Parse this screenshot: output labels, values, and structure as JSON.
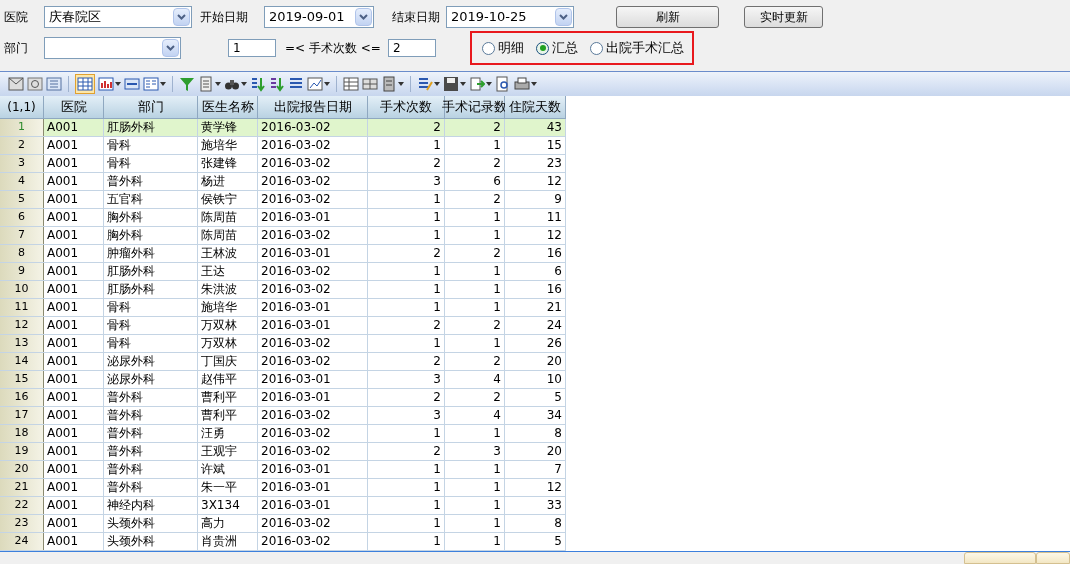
{
  "filters": {
    "hospital_label": "医院",
    "hospital": "庆春院区",
    "start_label": "开始日期",
    "start_date": "2019-09-01",
    "end_label": "结束日期",
    "end_date": "2019-10-25",
    "dept_label": "部门",
    "min_count": "1",
    "range_label": "=< 手术次数 <=",
    "max_count": "2"
  },
  "buttons": [
    "刷新",
    "实时更新"
  ],
  "view_options": [
    {
      "label": "明细",
      "selected": false
    },
    {
      "label": "汇总",
      "selected": true
    },
    {
      "label": "出院手术汇总",
      "selected": false
    }
  ],
  "table": {
    "corner": "(1,1)",
    "columns": [
      "医院",
      "部门",
      "医生名称",
      "出院报告日期",
      "手术次数",
      "手术记录数",
      "住院天数"
    ],
    "rows": [
      {
        "num": "1",
        "selected": true,
        "cells": [
          "A001",
          "肛肠外科",
          "黄学锋",
          "2016-03-02",
          "2",
          "2",
          "43"
        ]
      },
      {
        "num": "2",
        "selected": false,
        "cells": [
          "A001",
          "骨科",
          "施培华",
          "2016-03-02",
          "1",
          "1",
          "15"
        ]
      },
      {
        "num": "3",
        "selected": false,
        "cells": [
          "A001",
          "骨科",
          "张建锋",
          "2016-03-02",
          "2",
          "2",
          "23"
        ]
      },
      {
        "num": "4",
        "selected": false,
        "cells": [
          "A001",
          "普外科",
          "杨进",
          "2016-03-02",
          "3",
          "6",
          "12"
        ]
      },
      {
        "num": "5",
        "selected": false,
        "cells": [
          "A001",
          "五官科",
          "侯铁宁",
          "2016-03-02",
          "1",
          "2",
          "9"
        ]
      },
      {
        "num": "6",
        "selected": false,
        "cells": [
          "A001",
          "胸外科",
          "陈周苗",
          "2016-03-01",
          "1",
          "1",
          "11"
        ]
      },
      {
        "num": "7",
        "selected": false,
        "cells": [
          "A001",
          "胸外科",
          "陈周苗",
          "2016-03-02",
          "1",
          "1",
          "12"
        ]
      },
      {
        "num": "8",
        "selected": false,
        "cells": [
          "A001",
          "肿瘤外科",
          "王林波",
          "2016-03-01",
          "2",
          "2",
          "16"
        ]
      },
      {
        "num": "9",
        "selected": false,
        "cells": [
          "A001",
          "肛肠外科",
          "王达",
          "2016-03-02",
          "1",
          "1",
          "6"
        ]
      },
      {
        "num": "10",
        "selected": false,
        "cells": [
          "A001",
          "肛肠外科",
          "朱洪波",
          "2016-03-02",
          "1",
          "1",
          "16"
        ]
      },
      {
        "num": "11",
        "selected": false,
        "cells": [
          "A001",
          "骨科",
          "施培华",
          "2016-03-01",
          "1",
          "1",
          "21"
        ]
      },
      {
        "num": "12",
        "selected": false,
        "cells": [
          "A001",
          "骨科",
          "万双林",
          "2016-03-01",
          "2",
          "2",
          "24"
        ]
      },
      {
        "num": "13",
        "selected": false,
        "cells": [
          "A001",
          "骨科",
          "万双林",
          "2016-03-02",
          "1",
          "1",
          "26"
        ]
      },
      {
        "num": "14",
        "selected": false,
        "cells": [
          "A001",
          "泌尿外科",
          "丁国庆",
          "2016-03-02",
          "2",
          "2",
          "20"
        ]
      },
      {
        "num": "15",
        "selected": false,
        "cells": [
          "A001",
          "泌尿外科",
          "赵伟平",
          "2016-03-01",
          "3",
          "4",
          "10"
        ]
      },
      {
        "num": "16",
        "selected": false,
        "cells": [
          "A001",
          "普外科",
          "曹利平",
          "2016-03-01",
          "2",
          "2",
          "5"
        ]
      },
      {
        "num": "17",
        "selected": false,
        "cells": [
          "A001",
          "普外科",
          "曹利平",
          "2016-03-02",
          "3",
          "4",
          "34"
        ]
      },
      {
        "num": "18",
        "selected": false,
        "cells": [
          "A001",
          "普外科",
          "汪勇",
          "2016-03-02",
          "1",
          "1",
          "8"
        ]
      },
      {
        "num": "19",
        "selected": false,
        "cells": [
          "A001",
          "普外科",
          "王观宇",
          "2016-03-02",
          "2",
          "3",
          "20"
        ]
      },
      {
        "num": "20",
        "selected": false,
        "cells": [
          "A001",
          "普外科",
          "许斌",
          "2016-03-01",
          "1",
          "1",
          "7"
        ]
      },
      {
        "num": "21",
        "selected": false,
        "cells": [
          "A001",
          "普外科",
          "朱一平",
          "2016-03-01",
          "1",
          "1",
          "12"
        ]
      },
      {
        "num": "22",
        "selected": false,
        "cells": [
          "A001",
          "神经内科",
          "3X134",
          "2016-03-01",
          "1",
          "1",
          "33"
        ]
      },
      {
        "num": "23",
        "selected": false,
        "cells": [
          "A001",
          "头颈外科",
          "高力",
          "2016-03-02",
          "1",
          "1",
          "8"
        ]
      },
      {
        "num": "24",
        "selected": false,
        "cells": [
          "A001",
          "头颈外科",
          "肖贵洲",
          "2016-03-02",
          "1",
          "1",
          "5"
        ]
      }
    ]
  }
}
